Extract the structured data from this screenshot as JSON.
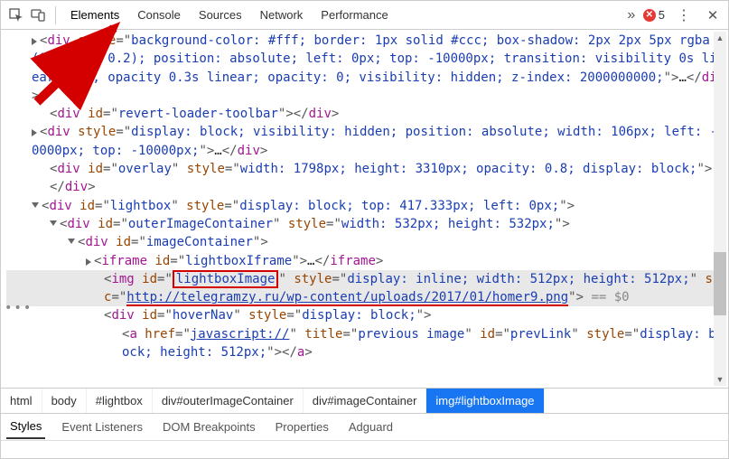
{
  "toolbar": {
    "tabs": {
      "elements": "Elements",
      "console": "Console",
      "sources": "Sources",
      "network": "Network",
      "performance": "Performance"
    },
    "error_count": "5"
  },
  "dom": {
    "l1": "<div style=\"background-color: #fff; border: 1px solid #ccc; box-shadow: 2px 2px 5px rgba(0, 0, 0, 0.2); position: absolute; left: 0px; top: -10000px; transition: visibility 0s linear 0.3s, opacity 0.3s linear; opacity: 0; visibility: hidden; z-index: 2000000000;\">…</div>",
    "l2": "<div id=\"revert-loader-toolbar\"></div>",
    "l3": "<div style=\"display: block; visibility: hidden; position: absolute; width: 106px; left: -10000px; top: -10000px;\">…</div>",
    "l4": "<div id=\"overlay\" style=\"width: 1798px; height: 3310px; opacity: 0.8; display: block;\"></div>",
    "l5": "<div id=\"lightbox\" style=\"display: block; top: 417.333px; left: 0px;\">",
    "l6": "<div id=\"outerImageContainer\" style=\"width: 532px; height: 532px;\">",
    "l7": "<div id=\"imageContainer\">",
    "l8": "<iframe id=\"lightboxIframe\">…</iframe>",
    "img_id": "lightboxImage",
    "img_style": "display: inline; width: 512px; height: 512px;",
    "img_src": "http://telegramzy.ru/wp-content/uploads/2017/01/homer9.png",
    "img_tail": " == $0",
    "l10": "<div id=\"hoverNav\" style=\"display: block;\">",
    "l11": "<a href=\"javascript://\" title=\"previous image\" id=\"prevLink\" style=\"display: block; height: 512px;\"></a>"
  },
  "breadcrumbs": {
    "b1": "html",
    "b2": "body",
    "b3": "#lightbox",
    "b4": "div#outerImageContainer",
    "b5": "div#imageContainer",
    "b6": "img#lightboxImage"
  },
  "subtabs": {
    "styles": "Styles",
    "events": "Event Listeners",
    "dombp": "DOM Breakpoints",
    "props": "Properties",
    "adguard": "Adguard"
  }
}
